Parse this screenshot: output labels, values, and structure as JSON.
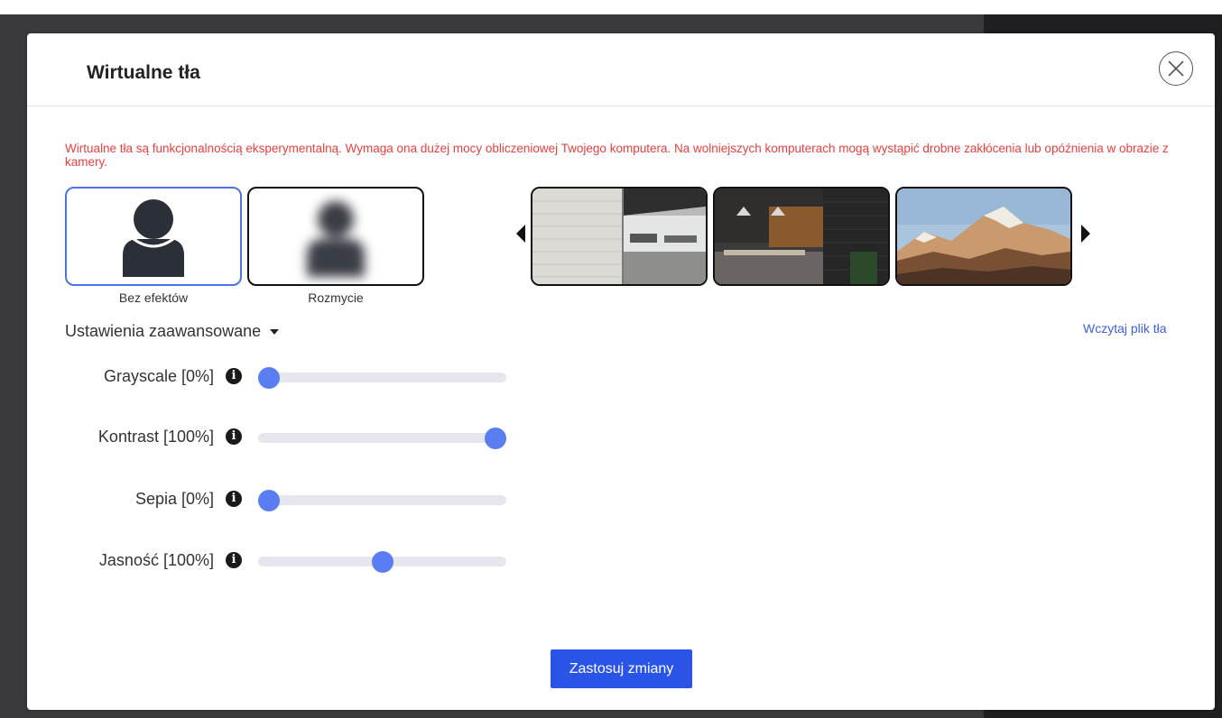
{
  "dialog": {
    "title": "Wirtualne tła",
    "warning": "Wirtualne tła są funkcjonalnością eksperymentalną. Wymaga ona dużej mocy obliczeniowej Twojego komputera. Na wolniejszych komputerach mogą wystąpić drobne zakłócenia lub opóźnienia w obrazie z kamery."
  },
  "effects": [
    {
      "label": "Bez efektów",
      "selected": true
    },
    {
      "label": "Rozmycie",
      "selected": false
    }
  ],
  "backgrounds": [
    "office-interior",
    "cafe-interior",
    "mountain-landscape"
  ],
  "advanced": {
    "toggle_label": "Ustawienia zaawansowane",
    "upload_label": "Wczytaj plik tła",
    "sliders": [
      {
        "label": "Grayscale [0%]",
        "value": 0
      },
      {
        "label": "Kontrast [100%]",
        "value": 1.0
      },
      {
        "label": "Sepia [0%]",
        "value": 0
      },
      {
        "label": "Jasność [100%]",
        "value": 0.5
      }
    ]
  },
  "apply_label": "Zastosuj zmiany",
  "colors": {
    "accent": "#2a54e8",
    "warning": "#e8403f",
    "slider_thumb": "#5a7ef2",
    "selected_border": "#4c74e6"
  }
}
